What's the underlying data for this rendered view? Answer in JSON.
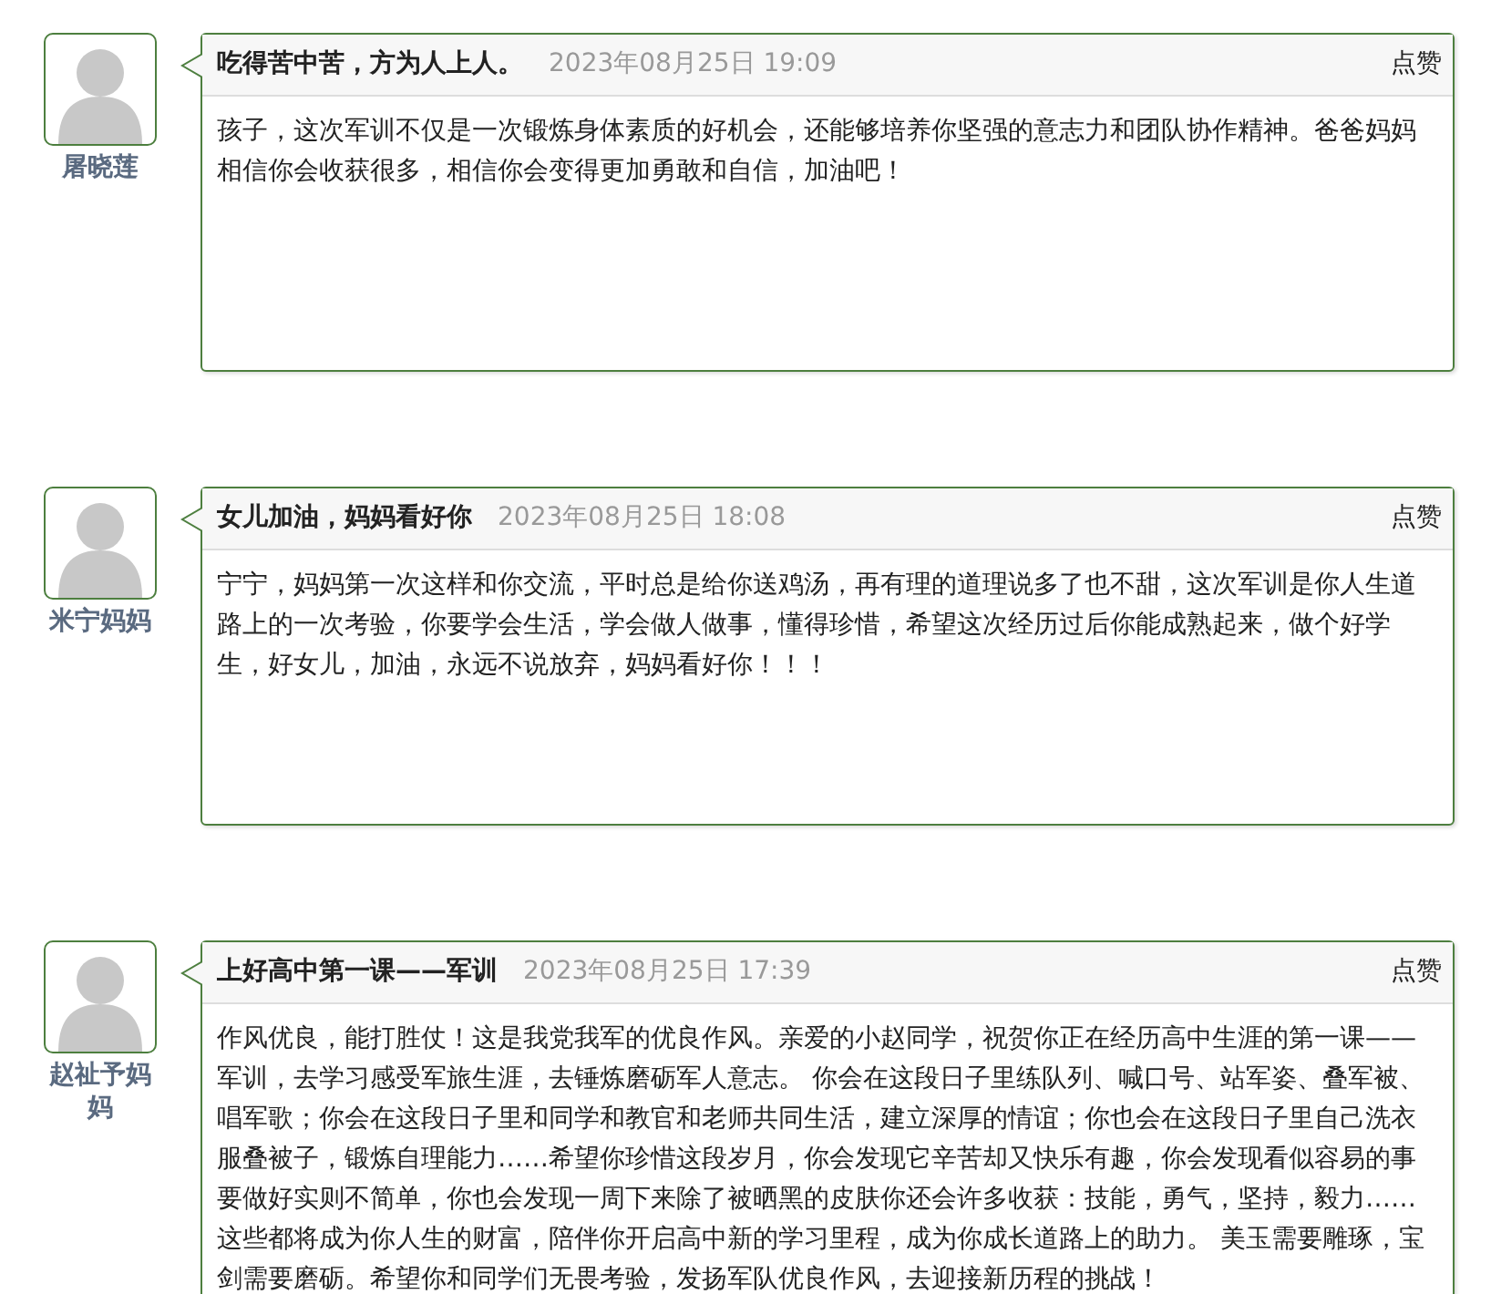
{
  "comments": [
    {
      "author": "屠晓莲",
      "title": "吃得苦中苦，方为人上人。",
      "time": "2023年08月25日 19:09",
      "like": "点赞",
      "body": "孩子，这次军训不仅是一次锻炼身体素质的好机会，还能够培养你坚强的意志力和团队协作精神。爸爸妈妈相信你会收获很多，相信你会变得更加勇敢和自信，加油吧！"
    },
    {
      "author": "米宁妈妈",
      "title": "女儿加油，妈妈看好你",
      "time": "2023年08月25日 18:08",
      "like": "点赞",
      "body": "宁宁，妈妈第一次这样和你交流，平时总是给你送鸡汤，再有理的道理说多了也不甜，这次军训是你人生道路上的一次考验，你要学会生活，学会做人做事，懂得珍惜，希望这次经历过后你能成熟起来，做个好学生，好女儿，加油，永远不说放弃，妈妈看好你！！！"
    },
    {
      "author": "赵祉予妈妈",
      "title": "上好高中第一课——军训",
      "time": "2023年08月25日 17:39",
      "like": "点赞",
      "body": "作风优良，能打胜仗！这是我党我军的优良作风。亲爱的小赵同学，祝贺你正在经历高中生涯的第一课——军训，去学习感受军旅生涯，去锤炼磨砺军人意志。 你会在这段日子里练队列、喊口号、站军姿、叠军被、唱军歌；你会在这段日子里和同学和教官和老师共同生活，建立深厚的情谊；你也会在这段日子里自己洗衣服叠被子，锻炼自理能力……希望你珍惜这段岁月，你会发现它辛苦却又快乐有趣，你会发现看似容易的事要做好实则不简单，你也会发现一周下来除了被晒黑的皮肤你还会许多收获：技能，勇气，坚持，毅力……这些都将成为你人生的财富，陪伴你开启高中新的学习里程，成为你成长道路上的助力。 美玉需要雕琢，宝剑需要磨砺。希望你和同学们无畏考验，发扬军队优良作风，去迎接新历程的挑战！"
    }
  ]
}
